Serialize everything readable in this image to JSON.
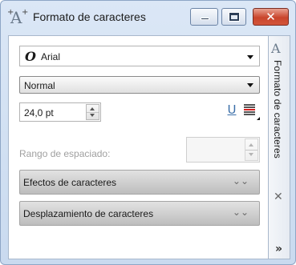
{
  "window": {
    "title": "Formato de caracteres",
    "icon": "character-format-icon",
    "buttons": {
      "minimize": "minimize-icon",
      "maximize": "maximize-icon",
      "close": "close-icon"
    }
  },
  "font": {
    "name": "Arial",
    "icon_glyph": "O"
  },
  "style": {
    "value": "Normal"
  },
  "size": {
    "value": "24,0 pt"
  },
  "tools": {
    "underline_glyph": "U",
    "strike_icon": "strikethrough-icon"
  },
  "spacing": {
    "label": "Rango de espaciado:",
    "value": ""
  },
  "sections": [
    {
      "label": "Efectos de caracteres",
      "chevron": "⌄⌄"
    },
    {
      "label": "Desplazamiento de caracteres",
      "chevron": "⌄⌄"
    }
  ],
  "sidetab": {
    "label": "Formato de caracteres",
    "close_glyph": "✕",
    "more_glyph": "»"
  }
}
